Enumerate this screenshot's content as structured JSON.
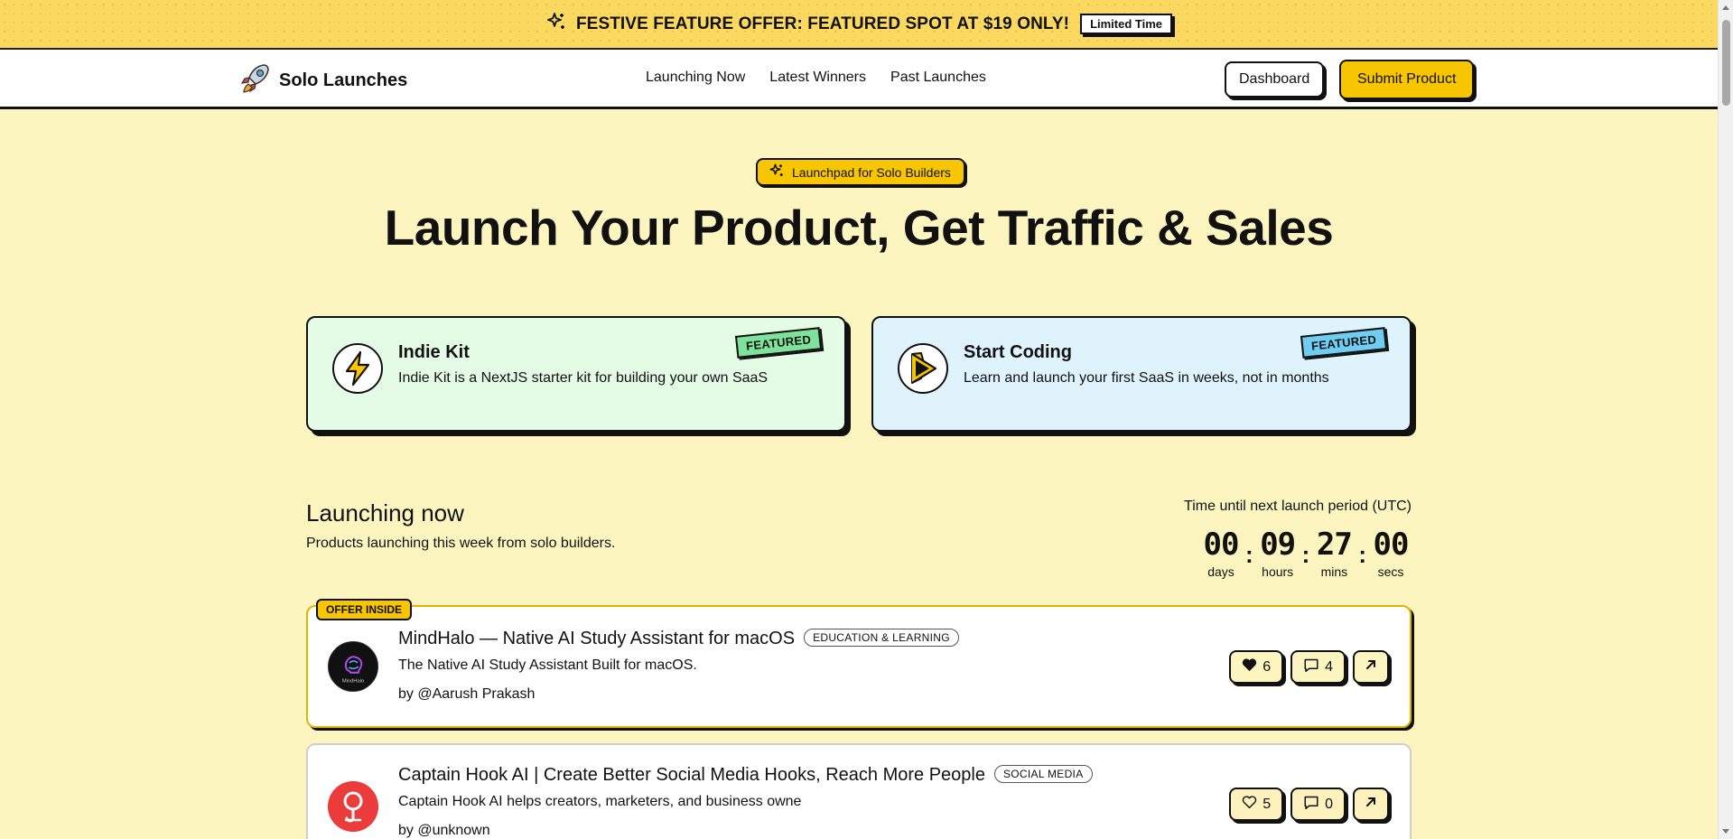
{
  "banner": {
    "text": "FESTIVE FEATURE OFFER: FEATURED SPOT AT $19 ONLY!",
    "badge": "Limited Time",
    "icon": "sparkles-icon",
    "bg_color": "#fbd961"
  },
  "nav": {
    "brand": "Solo Launches",
    "brand_icon": "rocket-icon",
    "links": [
      "Launching Now",
      "Latest Winners",
      "Past Launches"
    ],
    "dashboard_label": "Dashboard",
    "submit_label": "Submit Product",
    "accent_color": "#f7c600"
  },
  "hero": {
    "pill": "Launchpad for Solo Builders",
    "title": "Launch Your Product, Get Traffic & Sales"
  },
  "featured": [
    {
      "title": "Indie Kit",
      "desc": "Indie Kit is a NextJS starter kit for building your own SaaS",
      "badge": "FEATURED",
      "icon": "lightning-icon",
      "bg_color": "#e4fbe6"
    },
    {
      "title": "Start Coding",
      "desc": "Learn and launch your first SaaS in weeks, not in months",
      "badge": "FEATURED",
      "icon": "play-icon",
      "bg_color": "#def3fc"
    }
  ],
  "launching": {
    "title": "Launching now",
    "subtitle": "Products launching this week from solo builders.",
    "timer_label": "Time until next launch period (UTC)",
    "timer": [
      {
        "value": "00",
        "label": "days"
      },
      {
        "value": "09",
        "label": "hours"
      },
      {
        "value": "27",
        "label": "mins"
      },
      {
        "value": "00",
        "label": "secs"
      }
    ],
    "separator": ":"
  },
  "products": [
    {
      "offer_tag": "OFFER INSIDE",
      "title": "MindHalo — Native AI Study Assistant for macOS",
      "category": "EDUCATION & LEARNING",
      "desc": "The Native AI Study Assistant Built for macOS.",
      "author": "by @Aarush Prakash",
      "upvotes": "6",
      "comments": "4",
      "logo_text": "MindHalo",
      "upvoted": true
    },
    {
      "title": "Captain Hook AI | Create Better Social Media Hooks, Reach More People",
      "category": "SOCIAL MEDIA",
      "desc": "Captain Hook AI helps creators, marketers, and business owne",
      "author": "by @unknown",
      "upvotes": "5",
      "comments": "0",
      "upvoted": false
    }
  ]
}
